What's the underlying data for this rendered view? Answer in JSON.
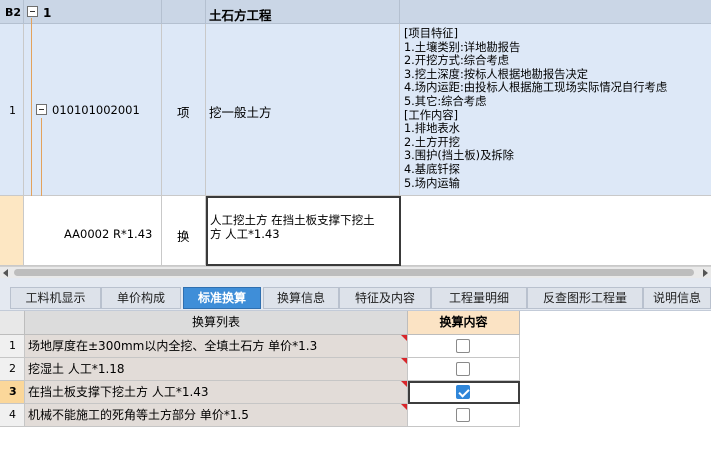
{
  "top_grid": {
    "header": {
      "index": "B2",
      "code": "1",
      "name": "土石方工程"
    },
    "item": {
      "index": "1",
      "code": "010101002001",
      "type": "项",
      "name": "挖一般土方",
      "features": [
        "[项目特征]",
        "1.土壤类别:详地勘报告",
        "2.开挖方式:综合考虑",
        "3.挖土深度:按标人根据地勘报告决定",
        "4.场内运距:由投标人根据施工现场实际情况自行考虑",
        "5.其它:综合考虑",
        "[工作内容]",
        "1.排地表水",
        "2.土方开挖",
        "3.围护(挡土板)及拆除",
        "4.基底钎探",
        "5.场内运输"
      ]
    },
    "sub_item": {
      "code": "AA0002 R*1.43",
      "type": "换",
      "name_line1": "人工挖土方  在挡土板支撑下挖土",
      "name_line2": "方 人工*1.43"
    }
  },
  "tabs": [
    {
      "label": "工料机显示",
      "active": false
    },
    {
      "label": "单价构成",
      "active": false
    },
    {
      "label": "标准换算",
      "active": true
    },
    {
      "label": "换算信息",
      "active": false
    },
    {
      "label": "特征及内容",
      "active": false
    },
    {
      "label": "工程量明细",
      "active": false
    },
    {
      "label": "反查图形工程量",
      "active": false
    },
    {
      "label": "说明信息",
      "active": false
    }
  ],
  "conversion_table": {
    "col_list": "换算列表",
    "col_content": "换算内容",
    "rows": [
      {
        "index": "1",
        "name": "场地厚度在±300mm以内全挖、全填土石方 单价*1.3",
        "checked": false
      },
      {
        "index": "2",
        "name": "挖湿土 人工*1.18",
        "checked": false
      },
      {
        "index": "3",
        "name": "在挡土板支撑下挖土方 人工*1.43",
        "checked": true
      },
      {
        "index": "4",
        "name": "机械不能施工的死角等土方部分 单价*1.5",
        "checked": false
      }
    ]
  },
  "colors": {
    "header_bg": "#cad6e6",
    "item_bg": "#dde8f7",
    "active_tab": "#3f8ed8",
    "tree_line": "#e3a25c",
    "selected_row": "#fbd79a",
    "red_marker": "#d8262b"
  }
}
